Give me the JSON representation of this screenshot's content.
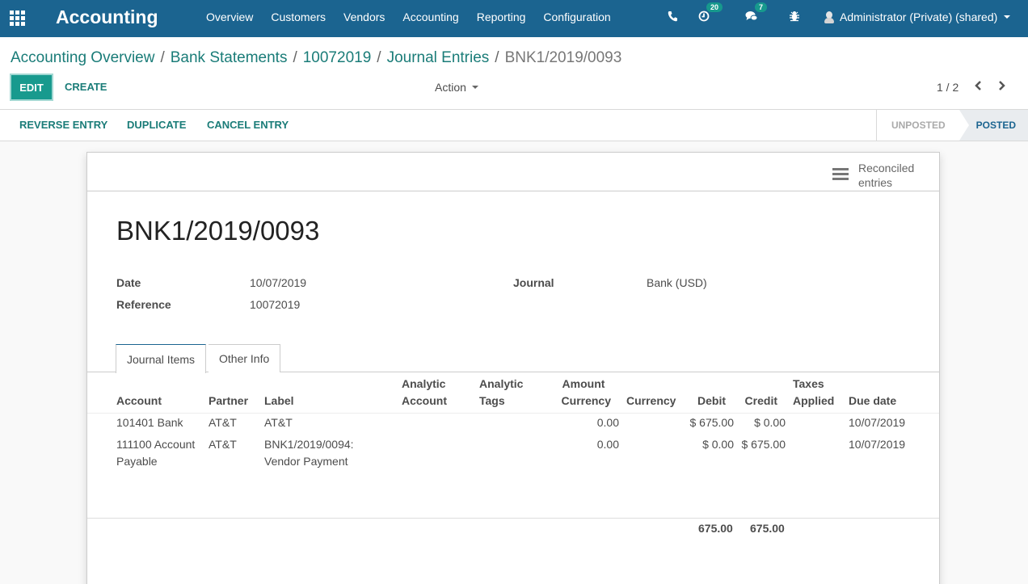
{
  "navbar": {
    "brand": "Accounting",
    "menu": [
      "Overview",
      "Customers",
      "Vendors",
      "Accounting",
      "Reporting",
      "Configuration"
    ],
    "activities_count": "20",
    "messages_count": "7",
    "user": "Administrator (Private) (shared)",
    "accent_color": "#1b6490",
    "badge_color": "#17998d"
  },
  "breadcrumb": {
    "items": [
      "Accounting Overview",
      "Bank Statements",
      "10072019",
      "Journal Entries"
    ],
    "current": "BNK1/2019/0093",
    "separator": "/"
  },
  "toolbar": {
    "edit_label": "EDIT",
    "create_label": "CREATE",
    "action_label": "Action",
    "pager": "1 / 2",
    "prev_icon": "‹",
    "next_icon": "›"
  },
  "statusbar": {
    "buttons": [
      "REVERSE ENTRY",
      "DUPLICATE",
      "CANCEL ENTRY"
    ],
    "stages": [
      "UNPOSTED",
      "POSTED"
    ],
    "current_stage": "POSTED"
  },
  "sheet": {
    "smart_button": {
      "line1": "Reconciled",
      "line2": "entries"
    },
    "title": "BNK1/2019/0093",
    "fields": {
      "date_label": "Date",
      "date_value": "10/07/2019",
      "reference_label": "Reference",
      "reference_value": "10072019",
      "journal_label": "Journal",
      "journal_value": "Bank (USD)"
    },
    "tabs": [
      "Journal Items",
      "Other Info"
    ],
    "active_tab": "Journal Items",
    "table": {
      "headers": {
        "account": "Account",
        "partner": "Partner",
        "label": "Label",
        "analytic_account_1": "Analytic",
        "analytic_account_2": "Account",
        "analytic_tags_1": "Analytic",
        "analytic_tags_2": "Tags",
        "amount_currency_1": "Amount",
        "amount_currency_2": "Currency",
        "currency": "Currency",
        "debit": "Debit",
        "credit": "Credit",
        "taxes_1": "Taxes",
        "taxes_2": "Applied",
        "due_date": "Due date"
      },
      "rows": [
        {
          "account_1": "101401 Bank",
          "account_2": "",
          "partner": "AT&T",
          "label_1": "AT&T",
          "label_2": "",
          "amount_currency": "0.00",
          "debit": "$ 675.00",
          "credit": "$ 0.00",
          "due_date": "10/07/2019"
        },
        {
          "account_1": "111100 Account",
          "account_2": "Payable",
          "partner": "AT&T",
          "label_1": "BNK1/2019/0094:",
          "label_2": "Vendor Payment",
          "amount_currency": "0.00",
          "debit": "$ 0.00",
          "credit": "$ 675.00",
          "due_date": "10/07/2019"
        }
      ],
      "totals": {
        "debit": "675.00",
        "credit": "675.00"
      }
    }
  }
}
